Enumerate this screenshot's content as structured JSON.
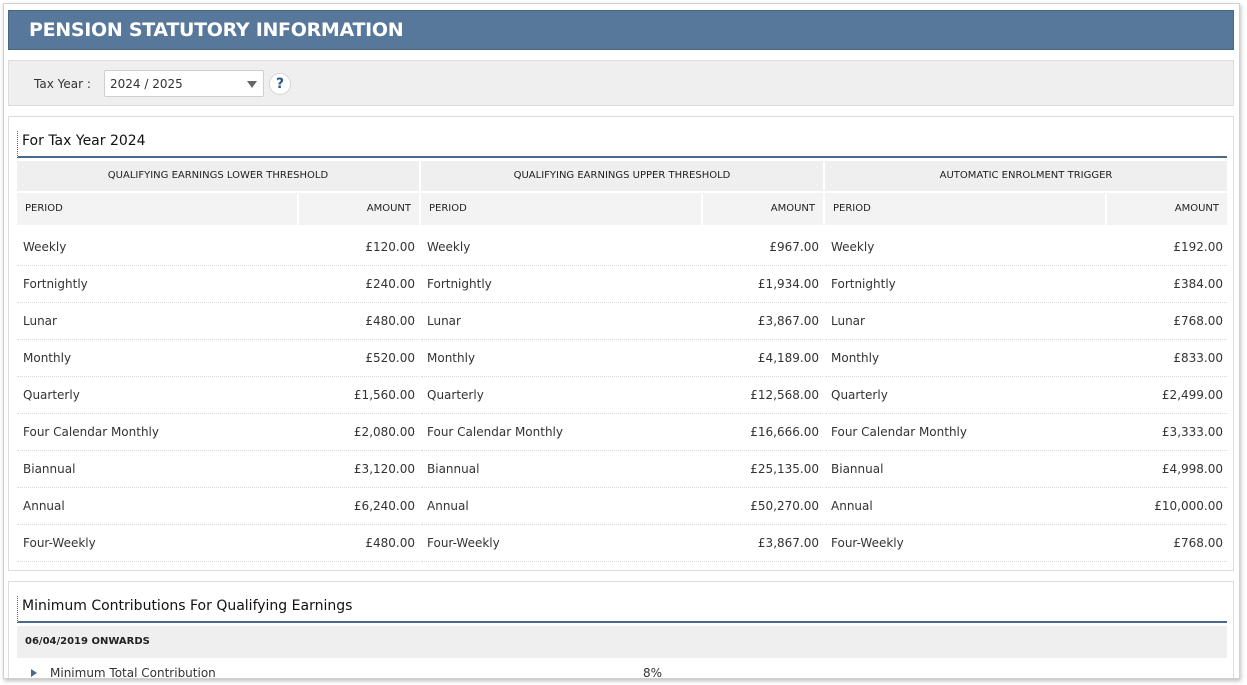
{
  "header": {
    "title": "PENSION STATUTORY INFORMATION"
  },
  "filter": {
    "tax_year_label": "Tax Year :",
    "tax_year_value": "2024 / 2025",
    "help_symbol": "?"
  },
  "section1": {
    "title": "For Tax Year 2024",
    "columns": [
      {
        "heading": "QUALIFYING EARNINGS LOWER THRESHOLD",
        "period_header": "PERIOD",
        "amount_header": "AMOUNT",
        "rows": [
          {
            "period": "Weekly",
            "amount": "£120.00"
          },
          {
            "period": "Fortnightly",
            "amount": "£240.00"
          },
          {
            "period": "Lunar",
            "amount": "£480.00"
          },
          {
            "period": "Monthly",
            "amount": "£520.00"
          },
          {
            "period": "Quarterly",
            "amount": "£1,560.00"
          },
          {
            "period": "Four Calendar Monthly",
            "amount": "£2,080.00"
          },
          {
            "period": "Biannual",
            "amount": "£3,120.00"
          },
          {
            "period": "Annual",
            "amount": "£6,240.00"
          },
          {
            "period": "Four-Weekly",
            "amount": "£480.00"
          }
        ]
      },
      {
        "heading": "QUALIFYING EARNINGS UPPER THRESHOLD",
        "period_header": "PERIOD",
        "amount_header": "AMOUNT",
        "rows": [
          {
            "period": "Weekly",
            "amount": "£967.00"
          },
          {
            "period": "Fortnightly",
            "amount": "£1,934.00"
          },
          {
            "period": "Lunar",
            "amount": "£3,867.00"
          },
          {
            "period": "Monthly",
            "amount": "£4,189.00"
          },
          {
            "period": "Quarterly",
            "amount": "£12,568.00"
          },
          {
            "period": "Four Calendar Monthly",
            "amount": "£16,666.00"
          },
          {
            "period": "Biannual",
            "amount": "£25,135.00"
          },
          {
            "period": "Annual",
            "amount": "£50,270.00"
          },
          {
            "period": "Four-Weekly",
            "amount": "£3,867.00"
          }
        ]
      },
      {
        "heading": "AUTOMATIC ENROLMENT TRIGGER",
        "period_header": "PERIOD",
        "amount_header": "AMOUNT",
        "rows": [
          {
            "period": "Weekly",
            "amount": "£192.00"
          },
          {
            "period": "Fortnightly",
            "amount": "£384.00"
          },
          {
            "period": "Lunar",
            "amount": "£768.00"
          },
          {
            "period": "Monthly",
            "amount": "£833.00"
          },
          {
            "period": "Quarterly",
            "amount": "£2,499.00"
          },
          {
            "period": "Four Calendar Monthly",
            "amount": "£3,333.00"
          },
          {
            "period": "Biannual",
            "amount": "£4,998.00"
          },
          {
            "period": "Annual",
            "amount": "£10,000.00"
          },
          {
            "period": "Four-Weekly",
            "amount": "£768.00"
          }
        ]
      }
    ]
  },
  "section2": {
    "title": "Minimum Contributions For Qualifying Earnings",
    "band": "06/04/2019 ONWARDS",
    "items": [
      {
        "label": "Minimum Total Contribution",
        "value": "8%"
      }
    ]
  }
}
